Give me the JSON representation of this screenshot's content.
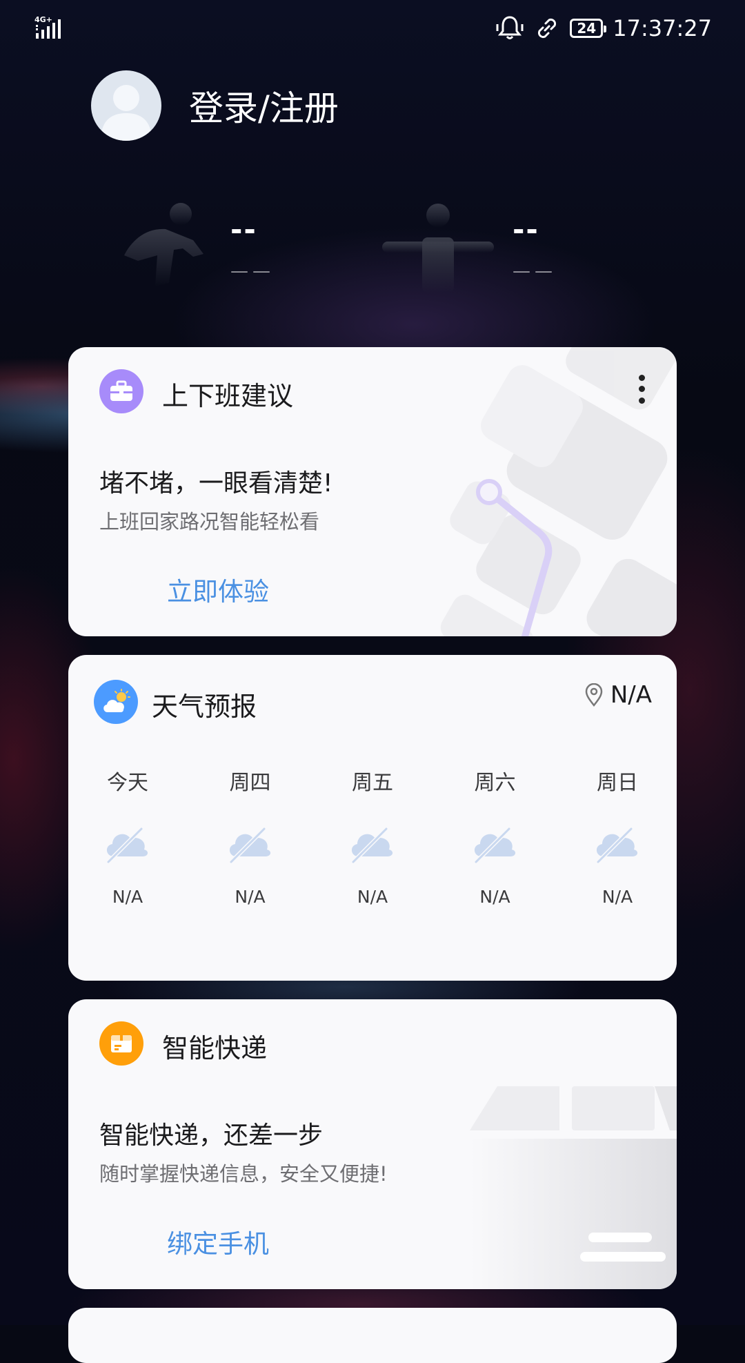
{
  "status_bar": {
    "network": "4G+",
    "battery": "24",
    "time": "17:37:27"
  },
  "profile": {
    "login_label": "登录/注册"
  },
  "stats": {
    "steps": {
      "value": "--",
      "unit": "——"
    },
    "standing": {
      "value": "--",
      "unit": "——"
    }
  },
  "commute_card": {
    "title": "上下班建议",
    "headline": "堵不堵，一眼看清楚!",
    "subtitle": "上班回家路况智能轻松看",
    "action": "立即体验",
    "accent": "#a78bfa"
  },
  "weather_card": {
    "title": "天气预报",
    "location": "N/A",
    "days": [
      {
        "name": "今天",
        "temp": "N/A"
      },
      {
        "name": "周四",
        "temp": "N/A"
      },
      {
        "name": "周五",
        "temp": "N/A"
      },
      {
        "name": "周六",
        "temp": "N/A"
      },
      {
        "name": "周日",
        "temp": "N/A"
      }
    ],
    "accent": "#4c9bff"
  },
  "express_card": {
    "title": "智能快递",
    "headline": "智能快递，还差一步",
    "subtitle": "随时掌握快递信息，安全又便捷!",
    "action": "绑定手机",
    "accent": "#ff9f0a"
  }
}
